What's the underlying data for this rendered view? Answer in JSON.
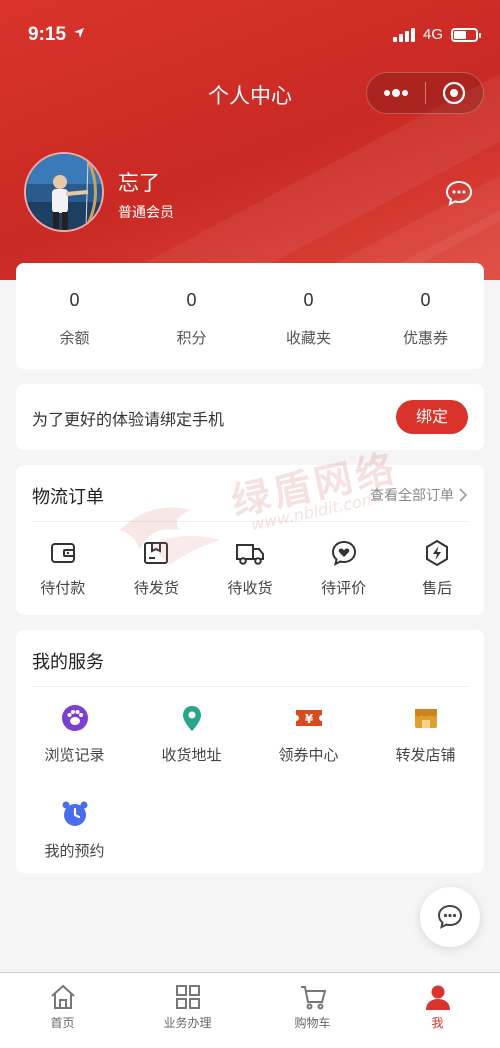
{
  "status_bar": {
    "time": "9:15",
    "network": "4G"
  },
  "nav": {
    "title": "个人中心"
  },
  "profile": {
    "name": "忘了",
    "level": "普通会员"
  },
  "stats": [
    {
      "value": "0",
      "label": "余额"
    },
    {
      "value": "0",
      "label": "积分"
    },
    {
      "value": "0",
      "label": "收藏夹"
    },
    {
      "value": "0",
      "label": "优惠券"
    }
  ],
  "bind_phone": {
    "text": "为了更好的体验请绑定手机",
    "button": "绑定"
  },
  "orders": {
    "title": "物流订单",
    "view_all": "查看全部订单",
    "items": [
      {
        "label": "待付款",
        "icon": "wallet-icon"
      },
      {
        "label": "待发货",
        "icon": "package-icon"
      },
      {
        "label": "待收货",
        "icon": "truck-icon"
      },
      {
        "label": "待评价",
        "icon": "heart-chat-icon"
      },
      {
        "label": "售后",
        "icon": "lightning-icon"
      }
    ]
  },
  "services": {
    "title": "我的服务",
    "items": [
      {
        "label": "浏览记录",
        "icon": "footprint-icon",
        "color": "#7b3fd1"
      },
      {
        "label": "收货地址",
        "icon": "location-icon",
        "color": "#2aa58a"
      },
      {
        "label": "领券中心",
        "icon": "coupon-icon",
        "color": "#d84b1e"
      },
      {
        "label": "转发店铺",
        "icon": "shop-icon",
        "color": "#e0a030"
      },
      {
        "label": "我的预约",
        "icon": "alarm-clock-icon",
        "color": "#4a6cf0"
      }
    ]
  },
  "watermark": {
    "text": "绿盾网络",
    "url": "www.nbldit.com"
  },
  "tabbar": [
    {
      "label": "首页",
      "icon": "home-icon",
      "active": false
    },
    {
      "label": "业务办理",
      "icon": "grid-icon",
      "active": false
    },
    {
      "label": "购物车",
      "icon": "cart-icon",
      "active": false
    },
    {
      "label": "我",
      "icon": "user-icon",
      "active": true
    }
  ],
  "colors": {
    "brand": "#d9332b",
    "background": "#f5f5f5"
  }
}
